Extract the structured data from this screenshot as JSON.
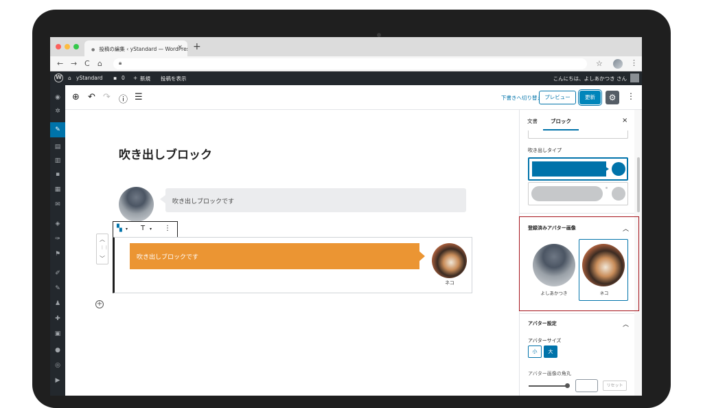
{
  "browser": {
    "tab_title": "投稿の編集 ‹ yStandard — WordPress",
    "new_tab": "+",
    "tab_close": "×",
    "nav_back": "←",
    "nav_forward": "→",
    "nav_reload": "C",
    "nav_home": "⌂",
    "star": "☆",
    "menu": "⋮"
  },
  "admin_bar": {
    "site_name": "yStandard",
    "comments_count": "0",
    "new_label": "新規",
    "view_post": "投稿を表示",
    "greeting": "こんにちは、よしあかつき さん"
  },
  "editor_header": {
    "add_block": "⊕",
    "undo": "↶",
    "redo": "↷",
    "info": "ⓘ",
    "outline": "☰",
    "switch_to_draft": "下書きへ切り替え",
    "preview": "プレビュー",
    "update": "更新",
    "settings": "⚙",
    "more": "⋮"
  },
  "post": {
    "title": "吹き出しブロック",
    "bubble1_text": "吹き出しブロックです",
    "bubble2_text": "吹き出しブロックです",
    "bubble2_name": "ネコ"
  },
  "block_toolbar": {
    "block_type": "▾",
    "align": "T",
    "align_arrow": "▾",
    "more": "⋮",
    "mover_up": "︿",
    "mover_drag": "⋮⋮",
    "mover_down": "﹀"
  },
  "sidebar": {
    "tab_document": "文書",
    "tab_block": "ブロック",
    "close": "×",
    "balloon_type_label": "吹き出しタイプ",
    "registered_avatar_label": "登録済みアバター画像",
    "avatars": [
      {
        "name": "よしあかつき",
        "selected": false
      },
      {
        "name": "ネコ",
        "selected": true
      }
    ],
    "avatar_settings_label": "アバター設定",
    "avatar_size_label": "アバターサイズ",
    "size_small": "小",
    "size_large": "大",
    "avatar_radius_label": "アバター画像の角丸",
    "reset": "リセット"
  },
  "colors": {
    "accent": "#0073aa",
    "orange_bubble": "#eb9533",
    "highlight_border": "#a5121a",
    "admin_bar": "#23282d"
  }
}
